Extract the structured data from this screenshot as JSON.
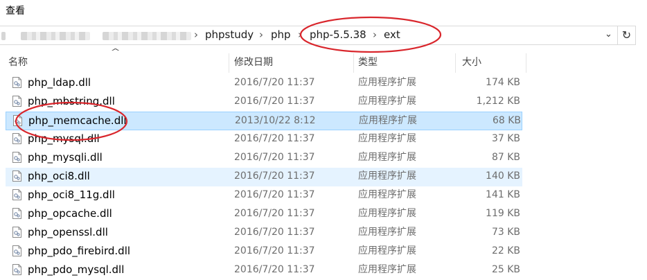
{
  "menu": {
    "view_label": "查看"
  },
  "address": {
    "crumbs": [
      "phpstudy",
      "php",
      "php-5.5.38",
      "ext"
    ],
    "separator": "›",
    "dropdown_glyph": "⌄",
    "refresh_glyph": "↻"
  },
  "columns": {
    "name": "名称",
    "date": "修改日期",
    "type": "类型",
    "size": "大小"
  },
  "sort_indicator": "^",
  "files": [
    {
      "name": "php_ldap.dll",
      "date": "2016/7/20 11:37",
      "type": "应用程序扩展",
      "size": "174 KB",
      "state": "normal"
    },
    {
      "name": "php_mbstring.dll",
      "date": "2016/7/20 11:37",
      "type": "应用程序扩展",
      "size": "1,212 KB",
      "state": "normal"
    },
    {
      "name": "php_memcache.dll",
      "date": "2013/10/22 8:12",
      "type": "应用程序扩展",
      "size": "68 KB",
      "state": "selected"
    },
    {
      "name": "php_mysql.dll",
      "date": "2016/7/20 11:37",
      "type": "应用程序扩展",
      "size": "37 KB",
      "state": "normal"
    },
    {
      "name": "php_mysqli.dll",
      "date": "2016/7/20 11:37",
      "type": "应用程序扩展",
      "size": "87 KB",
      "state": "normal"
    },
    {
      "name": "php_oci8.dll",
      "date": "2016/7/20 11:37",
      "type": "应用程序扩展",
      "size": "140 KB",
      "state": "hover"
    },
    {
      "name": "php_oci8_11g.dll",
      "date": "2016/7/20 11:37",
      "type": "应用程序扩展",
      "size": "141 KB",
      "state": "normal"
    },
    {
      "name": "php_opcache.dll",
      "date": "2016/7/20 11:37",
      "type": "应用程序扩展",
      "size": "119 KB",
      "state": "normal"
    },
    {
      "name": "php_openssl.dll",
      "date": "2016/7/20 11:37",
      "type": "应用程序扩展",
      "size": "73 KB",
      "state": "normal"
    },
    {
      "name": "php_pdo_firebird.dll",
      "date": "2016/7/20 11:37",
      "type": "应用程序扩展",
      "size": "22 KB",
      "state": "normal"
    },
    {
      "name": "php_pdo_mysql.dll",
      "date": "2016/7/20 11:37",
      "type": "应用程序扩展",
      "size": "25 KB",
      "state": "normal"
    }
  ],
  "colors": {
    "selected_bg": "#cce8ff",
    "selected_border": "#99d1ff",
    "hover_bg": "#e5f3ff",
    "annotation": "#d9262c"
  }
}
